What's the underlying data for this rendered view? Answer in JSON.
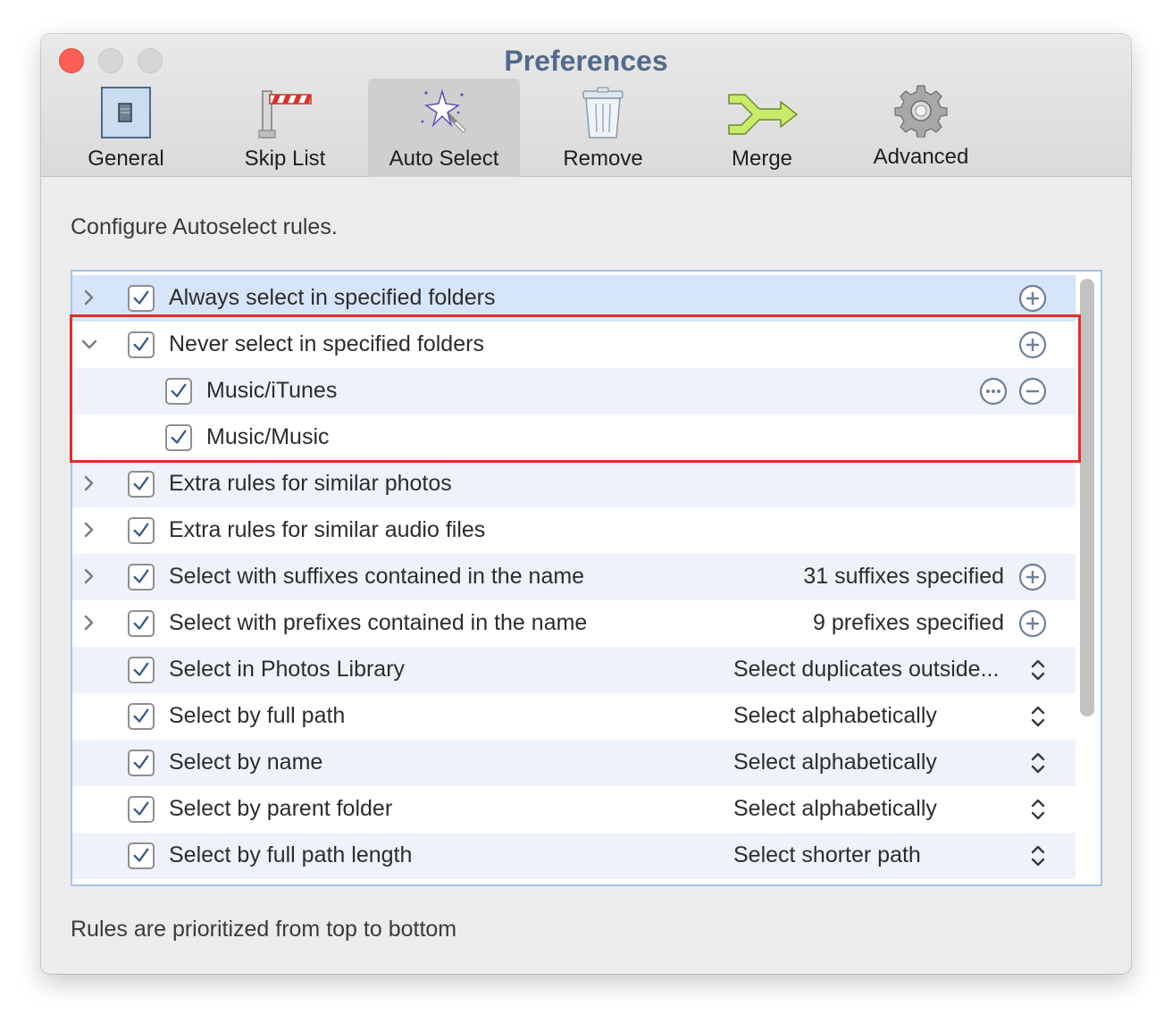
{
  "window": {
    "title": "Preferences"
  },
  "colors": {
    "accent": "#536a8c",
    "highlight": "#e8292a",
    "row_alt": "#eef3fb",
    "row_selected": "#d7e5f9"
  },
  "tabs": [
    {
      "label": "General",
      "icon": "general-switch-icon",
      "active": false
    },
    {
      "label": "Skip List",
      "icon": "barrier-icon",
      "active": false
    },
    {
      "label": "Auto Select",
      "icon": "magic-wand-icon",
      "active": true
    },
    {
      "label": "Remove",
      "icon": "trash-icon",
      "active": false
    },
    {
      "label": "Merge",
      "icon": "merge-arrow-icon",
      "active": false
    },
    {
      "label": "Advanced",
      "icon": "gear-icon",
      "active": false
    }
  ],
  "description": "Configure Autoselect rules.",
  "footer": "Rules are prioritized from top to bottom",
  "rules": [
    {
      "label": "Always select in specified folders",
      "checked": true,
      "disclosure": "collapsed",
      "value": "",
      "action": "add"
    },
    {
      "label": "Never select in specified folders",
      "checked": true,
      "disclosure": "expanded",
      "value": "",
      "action": "add"
    },
    {
      "label": "Music/iTunes",
      "checked": true,
      "disclosure": "none",
      "child": true,
      "value": "",
      "action": "more-remove"
    },
    {
      "label": "Music/Music",
      "checked": true,
      "disclosure": "none",
      "child": true,
      "value": "",
      "action": "none"
    },
    {
      "label": "Extra rules for similar photos",
      "checked": true,
      "disclosure": "collapsed",
      "value": "",
      "action": "none"
    },
    {
      "label": "Extra rules for similar audio files",
      "checked": true,
      "disclosure": "collapsed",
      "value": "",
      "action": "none"
    },
    {
      "label": "Select with suffixes contained in the name",
      "checked": true,
      "disclosure": "collapsed",
      "value": "31 suffixes specified",
      "action": "add"
    },
    {
      "label": "Select with prefixes contained in the name",
      "checked": true,
      "disclosure": "collapsed",
      "value": "9 prefixes specified",
      "action": "add"
    },
    {
      "label": "Select in Photos Library",
      "checked": true,
      "disclosure": "none",
      "value": "Select duplicates outside...",
      "action": "stepper"
    },
    {
      "label": "Select by full path",
      "checked": true,
      "disclosure": "none",
      "value": "Select alphabetically",
      "action": "stepper"
    },
    {
      "label": "Select by name",
      "checked": true,
      "disclosure": "none",
      "value": "Select alphabetically",
      "action": "stepper"
    },
    {
      "label": "Select by parent folder",
      "checked": true,
      "disclosure": "none",
      "value": "Select alphabetically",
      "action": "stepper"
    },
    {
      "label": "Select by full path length",
      "checked": true,
      "disclosure": "none",
      "value": "Select shorter path",
      "action": "stepper"
    }
  ]
}
